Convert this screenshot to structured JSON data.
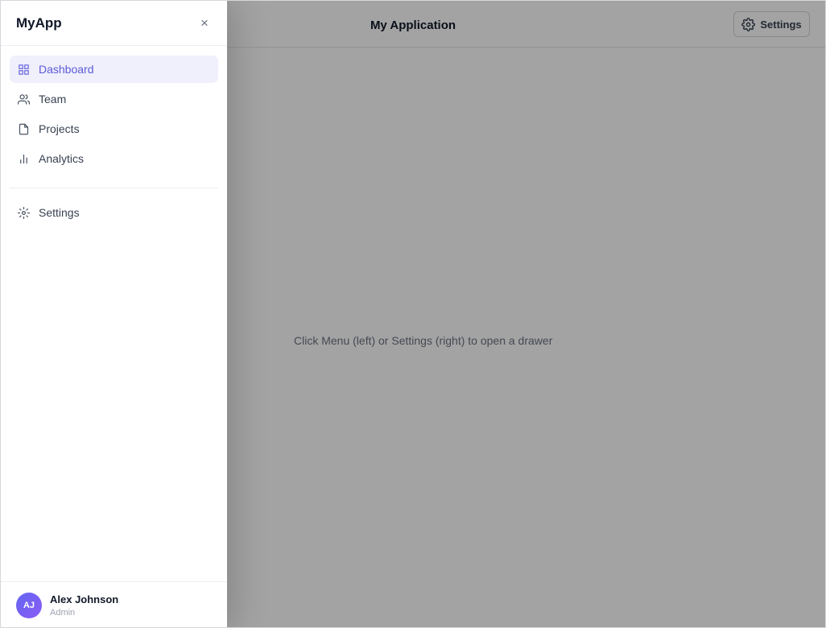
{
  "header": {
    "title": "My Application",
    "settings_label": "Settings"
  },
  "main": {
    "hint": "Click Menu (left) or Settings (right) to open a drawer"
  },
  "drawer": {
    "brand": "MyApp",
    "close_symbol": "×",
    "nav": [
      {
        "label": "Dashboard",
        "icon": "grid-icon",
        "active": true
      },
      {
        "label": "Team",
        "icon": "users-icon",
        "active": false
      },
      {
        "label": "Projects",
        "icon": "file-icon",
        "active": false
      },
      {
        "label": "Analytics",
        "icon": "bar-chart-icon",
        "active": false
      }
    ],
    "secondary_nav": [
      {
        "label": "Settings",
        "icon": "sun-gear-icon",
        "active": false
      }
    ],
    "user": {
      "initials": "AJ",
      "name": "Alex Johnson",
      "role": "Admin"
    }
  },
  "colors": {
    "accent": "#5b5bd6",
    "active_bg": "#f0effc",
    "overlay": "rgba(0,0,0,0.36)"
  }
}
